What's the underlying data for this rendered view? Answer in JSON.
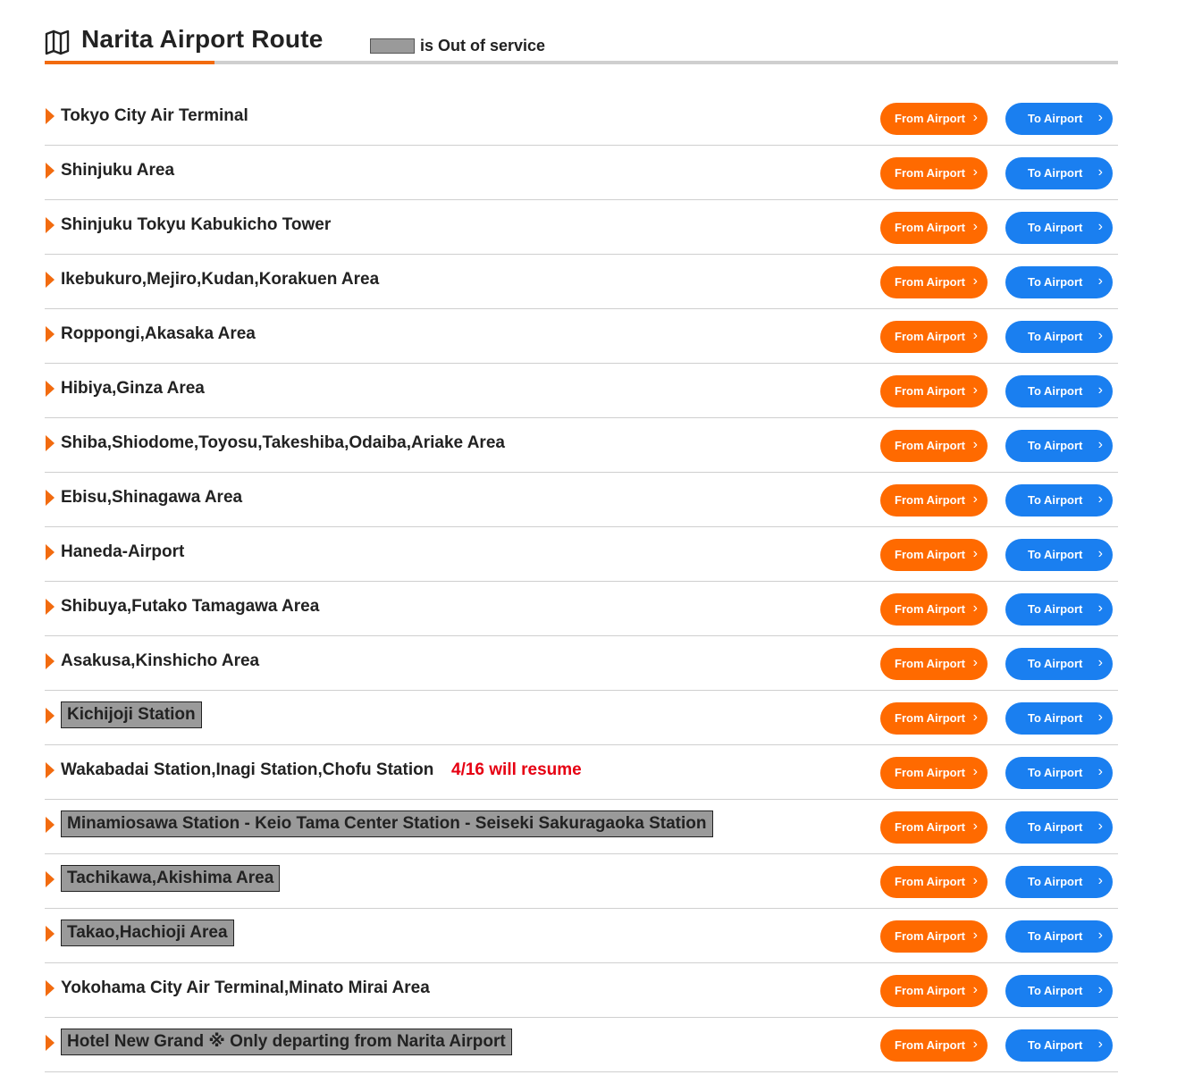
{
  "header": {
    "title": "Narita Airport Route",
    "legend_text": "is Out of service",
    "icon": "map-icon"
  },
  "colors": {
    "accent": "#f26b0f",
    "from_button": "#ff6a00",
    "to_button": "#1a7ff0",
    "out_of_service": "#9a9a9a",
    "note": "#e60012"
  },
  "buttons": {
    "from_label": "From Airport",
    "to_label": "To Airport",
    "chevron": "›"
  },
  "routes": [
    {
      "name": "Tokyo City Air Terminal",
      "out_of_service": false,
      "note": ""
    },
    {
      "name": "Shinjuku Area",
      "out_of_service": false,
      "note": ""
    },
    {
      "name": "Shinjuku Tokyu Kabukicho Tower",
      "out_of_service": false,
      "note": ""
    },
    {
      "name": "Ikebukuro,Mejiro,Kudan,Korakuen Area",
      "out_of_service": false,
      "note": ""
    },
    {
      "name": "Roppongi,Akasaka Area",
      "out_of_service": false,
      "note": ""
    },
    {
      "name": "Hibiya,Ginza Area",
      "out_of_service": false,
      "note": ""
    },
    {
      "name": "Shiba,Shiodome,Toyosu,Takeshiba,Odaiba,Ariake Area",
      "out_of_service": false,
      "note": ""
    },
    {
      "name": "Ebisu,Shinagawa Area",
      "out_of_service": false,
      "note": ""
    },
    {
      "name": "Haneda-Airport",
      "out_of_service": false,
      "note": ""
    },
    {
      "name": "Shibuya,Futako Tamagawa Area",
      "out_of_service": false,
      "note": ""
    },
    {
      "name": "Asakusa,Kinshicho Area",
      "out_of_service": false,
      "note": ""
    },
    {
      "name": "Kichijoji Station",
      "out_of_service": true,
      "note": ""
    },
    {
      "name": "Wakabadai Station,Inagi Station,Chofu Station",
      "out_of_service": false,
      "note": "4/16 will resume"
    },
    {
      "name": "Minamiosawa Station - Keio Tama Center Station - Seiseki Sakuragaoka Station",
      "out_of_service": true,
      "note": ""
    },
    {
      "name": "Tachikawa,Akishima Area",
      "out_of_service": true,
      "note": ""
    },
    {
      "name": "Takao,Hachioji Area",
      "out_of_service": true,
      "note": ""
    },
    {
      "name": "Yokohama City Air Terminal,Minato Mirai Area",
      "out_of_service": false,
      "note": ""
    },
    {
      "name": "Hotel New Grand ※ Only departing from Narita Airport",
      "out_of_service": true,
      "note": ""
    }
  ]
}
